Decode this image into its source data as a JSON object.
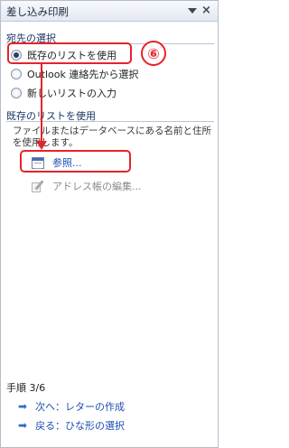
{
  "pane": {
    "title": "差し込み印刷",
    "dropdown_icon": "dropdown-triangle",
    "close_icon": "×"
  },
  "recipient": {
    "heading": "宛先の選択",
    "options": [
      {
        "label": "既存のリストを使用",
        "checked": true
      },
      {
        "label": "Outlook 連絡先から選択",
        "checked": false
      },
      {
        "label": "新しいリストの入力",
        "checked": false
      }
    ]
  },
  "existing_list": {
    "heading": "既存のリストを使用",
    "description": "ファイルまたはデータベースにある名前と住所を使用します。",
    "browse_label": "参照...",
    "edit_label": "アドレス帳の編集..."
  },
  "wizard": {
    "step": "手順 3/6",
    "next_label": "次へ：レターの作成",
    "back_label": "戻る：ひな形の選択",
    "arrow_glyph": "➡"
  },
  "annotation": {
    "number": "⑥",
    "color": "#e8222a"
  }
}
